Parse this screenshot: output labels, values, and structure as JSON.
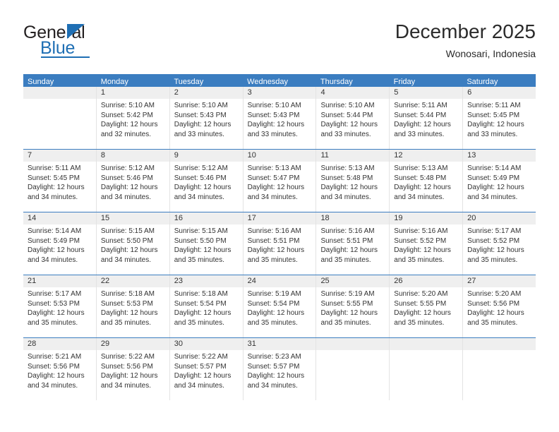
{
  "logo": {
    "line1": "General",
    "line2": "Blue",
    "triangle_icon": "triangle-icon",
    "accent_color": "#1f6fb4"
  },
  "header": {
    "month_title": "December 2025",
    "location": "Wonosari, Indonesia"
  },
  "theme": {
    "header_blue": "#3b7dc0",
    "day_band_gray": "#efefef",
    "grid_gray": "#e3e3e3"
  },
  "calendar": {
    "weekdays": [
      "Sunday",
      "Monday",
      "Tuesday",
      "Wednesday",
      "Thursday",
      "Friday",
      "Saturday"
    ],
    "weeks": [
      [
        {
          "day": "",
          "empty": true
        },
        {
          "day": "1",
          "sunrise": "Sunrise: 5:10 AM",
          "sunset": "Sunset: 5:42 PM",
          "daylight1": "Daylight: 12 hours",
          "daylight2": "and 32 minutes."
        },
        {
          "day": "2",
          "sunrise": "Sunrise: 5:10 AM",
          "sunset": "Sunset: 5:43 PM",
          "daylight1": "Daylight: 12 hours",
          "daylight2": "and 33 minutes."
        },
        {
          "day": "3",
          "sunrise": "Sunrise: 5:10 AM",
          "sunset": "Sunset: 5:43 PM",
          "daylight1": "Daylight: 12 hours",
          "daylight2": "and 33 minutes."
        },
        {
          "day": "4",
          "sunrise": "Sunrise: 5:10 AM",
          "sunset": "Sunset: 5:44 PM",
          "daylight1": "Daylight: 12 hours",
          "daylight2": "and 33 minutes."
        },
        {
          "day": "5",
          "sunrise": "Sunrise: 5:11 AM",
          "sunset": "Sunset: 5:44 PM",
          "daylight1": "Daylight: 12 hours",
          "daylight2": "and 33 minutes."
        },
        {
          "day": "6",
          "sunrise": "Sunrise: 5:11 AM",
          "sunset": "Sunset: 5:45 PM",
          "daylight1": "Daylight: 12 hours",
          "daylight2": "and 33 minutes."
        }
      ],
      [
        {
          "day": "7",
          "sunrise": "Sunrise: 5:11 AM",
          "sunset": "Sunset: 5:45 PM",
          "daylight1": "Daylight: 12 hours",
          "daylight2": "and 34 minutes."
        },
        {
          "day": "8",
          "sunrise": "Sunrise: 5:12 AM",
          "sunset": "Sunset: 5:46 PM",
          "daylight1": "Daylight: 12 hours",
          "daylight2": "and 34 minutes."
        },
        {
          "day": "9",
          "sunrise": "Sunrise: 5:12 AM",
          "sunset": "Sunset: 5:46 PM",
          "daylight1": "Daylight: 12 hours",
          "daylight2": "and 34 minutes."
        },
        {
          "day": "10",
          "sunrise": "Sunrise: 5:13 AM",
          "sunset": "Sunset: 5:47 PM",
          "daylight1": "Daylight: 12 hours",
          "daylight2": "and 34 minutes."
        },
        {
          "day": "11",
          "sunrise": "Sunrise: 5:13 AM",
          "sunset": "Sunset: 5:48 PM",
          "daylight1": "Daylight: 12 hours",
          "daylight2": "and 34 minutes."
        },
        {
          "day": "12",
          "sunrise": "Sunrise: 5:13 AM",
          "sunset": "Sunset: 5:48 PM",
          "daylight1": "Daylight: 12 hours",
          "daylight2": "and 34 minutes."
        },
        {
          "day": "13",
          "sunrise": "Sunrise: 5:14 AM",
          "sunset": "Sunset: 5:49 PM",
          "daylight1": "Daylight: 12 hours",
          "daylight2": "and 34 minutes."
        }
      ],
      [
        {
          "day": "14",
          "sunrise": "Sunrise: 5:14 AM",
          "sunset": "Sunset: 5:49 PM",
          "daylight1": "Daylight: 12 hours",
          "daylight2": "and 34 minutes."
        },
        {
          "day": "15",
          "sunrise": "Sunrise: 5:15 AM",
          "sunset": "Sunset: 5:50 PM",
          "daylight1": "Daylight: 12 hours",
          "daylight2": "and 34 minutes."
        },
        {
          "day": "16",
          "sunrise": "Sunrise: 5:15 AM",
          "sunset": "Sunset: 5:50 PM",
          "daylight1": "Daylight: 12 hours",
          "daylight2": "and 35 minutes."
        },
        {
          "day": "17",
          "sunrise": "Sunrise: 5:16 AM",
          "sunset": "Sunset: 5:51 PM",
          "daylight1": "Daylight: 12 hours",
          "daylight2": "and 35 minutes."
        },
        {
          "day": "18",
          "sunrise": "Sunrise: 5:16 AM",
          "sunset": "Sunset: 5:51 PM",
          "daylight1": "Daylight: 12 hours",
          "daylight2": "and 35 minutes."
        },
        {
          "day": "19",
          "sunrise": "Sunrise: 5:16 AM",
          "sunset": "Sunset: 5:52 PM",
          "daylight1": "Daylight: 12 hours",
          "daylight2": "and 35 minutes."
        },
        {
          "day": "20",
          "sunrise": "Sunrise: 5:17 AM",
          "sunset": "Sunset: 5:52 PM",
          "daylight1": "Daylight: 12 hours",
          "daylight2": "and 35 minutes."
        }
      ],
      [
        {
          "day": "21",
          "sunrise": "Sunrise: 5:17 AM",
          "sunset": "Sunset: 5:53 PM",
          "daylight1": "Daylight: 12 hours",
          "daylight2": "and 35 minutes."
        },
        {
          "day": "22",
          "sunrise": "Sunrise: 5:18 AM",
          "sunset": "Sunset: 5:53 PM",
          "daylight1": "Daylight: 12 hours",
          "daylight2": "and 35 minutes."
        },
        {
          "day": "23",
          "sunrise": "Sunrise: 5:18 AM",
          "sunset": "Sunset: 5:54 PM",
          "daylight1": "Daylight: 12 hours",
          "daylight2": "and 35 minutes."
        },
        {
          "day": "24",
          "sunrise": "Sunrise: 5:19 AM",
          "sunset": "Sunset: 5:54 PM",
          "daylight1": "Daylight: 12 hours",
          "daylight2": "and 35 minutes."
        },
        {
          "day": "25",
          "sunrise": "Sunrise: 5:19 AM",
          "sunset": "Sunset: 5:55 PM",
          "daylight1": "Daylight: 12 hours",
          "daylight2": "and 35 minutes."
        },
        {
          "day": "26",
          "sunrise": "Sunrise: 5:20 AM",
          "sunset": "Sunset: 5:55 PM",
          "daylight1": "Daylight: 12 hours",
          "daylight2": "and 35 minutes."
        },
        {
          "day": "27",
          "sunrise": "Sunrise: 5:20 AM",
          "sunset": "Sunset: 5:56 PM",
          "daylight1": "Daylight: 12 hours",
          "daylight2": "and 35 minutes."
        }
      ],
      [
        {
          "day": "28",
          "sunrise": "Sunrise: 5:21 AM",
          "sunset": "Sunset: 5:56 PM",
          "daylight1": "Daylight: 12 hours",
          "daylight2": "and 34 minutes."
        },
        {
          "day": "29",
          "sunrise": "Sunrise: 5:22 AM",
          "sunset": "Sunset: 5:56 PM",
          "daylight1": "Daylight: 12 hours",
          "daylight2": "and 34 minutes."
        },
        {
          "day": "30",
          "sunrise": "Sunrise: 5:22 AM",
          "sunset": "Sunset: 5:57 PM",
          "daylight1": "Daylight: 12 hours",
          "daylight2": "and 34 minutes."
        },
        {
          "day": "31",
          "sunrise": "Sunrise: 5:23 AM",
          "sunset": "Sunset: 5:57 PM",
          "daylight1": "Daylight: 12 hours",
          "daylight2": "and 34 minutes."
        },
        {
          "day": "",
          "empty": true
        },
        {
          "day": "",
          "empty": true
        },
        {
          "day": "",
          "empty": true
        }
      ]
    ]
  }
}
